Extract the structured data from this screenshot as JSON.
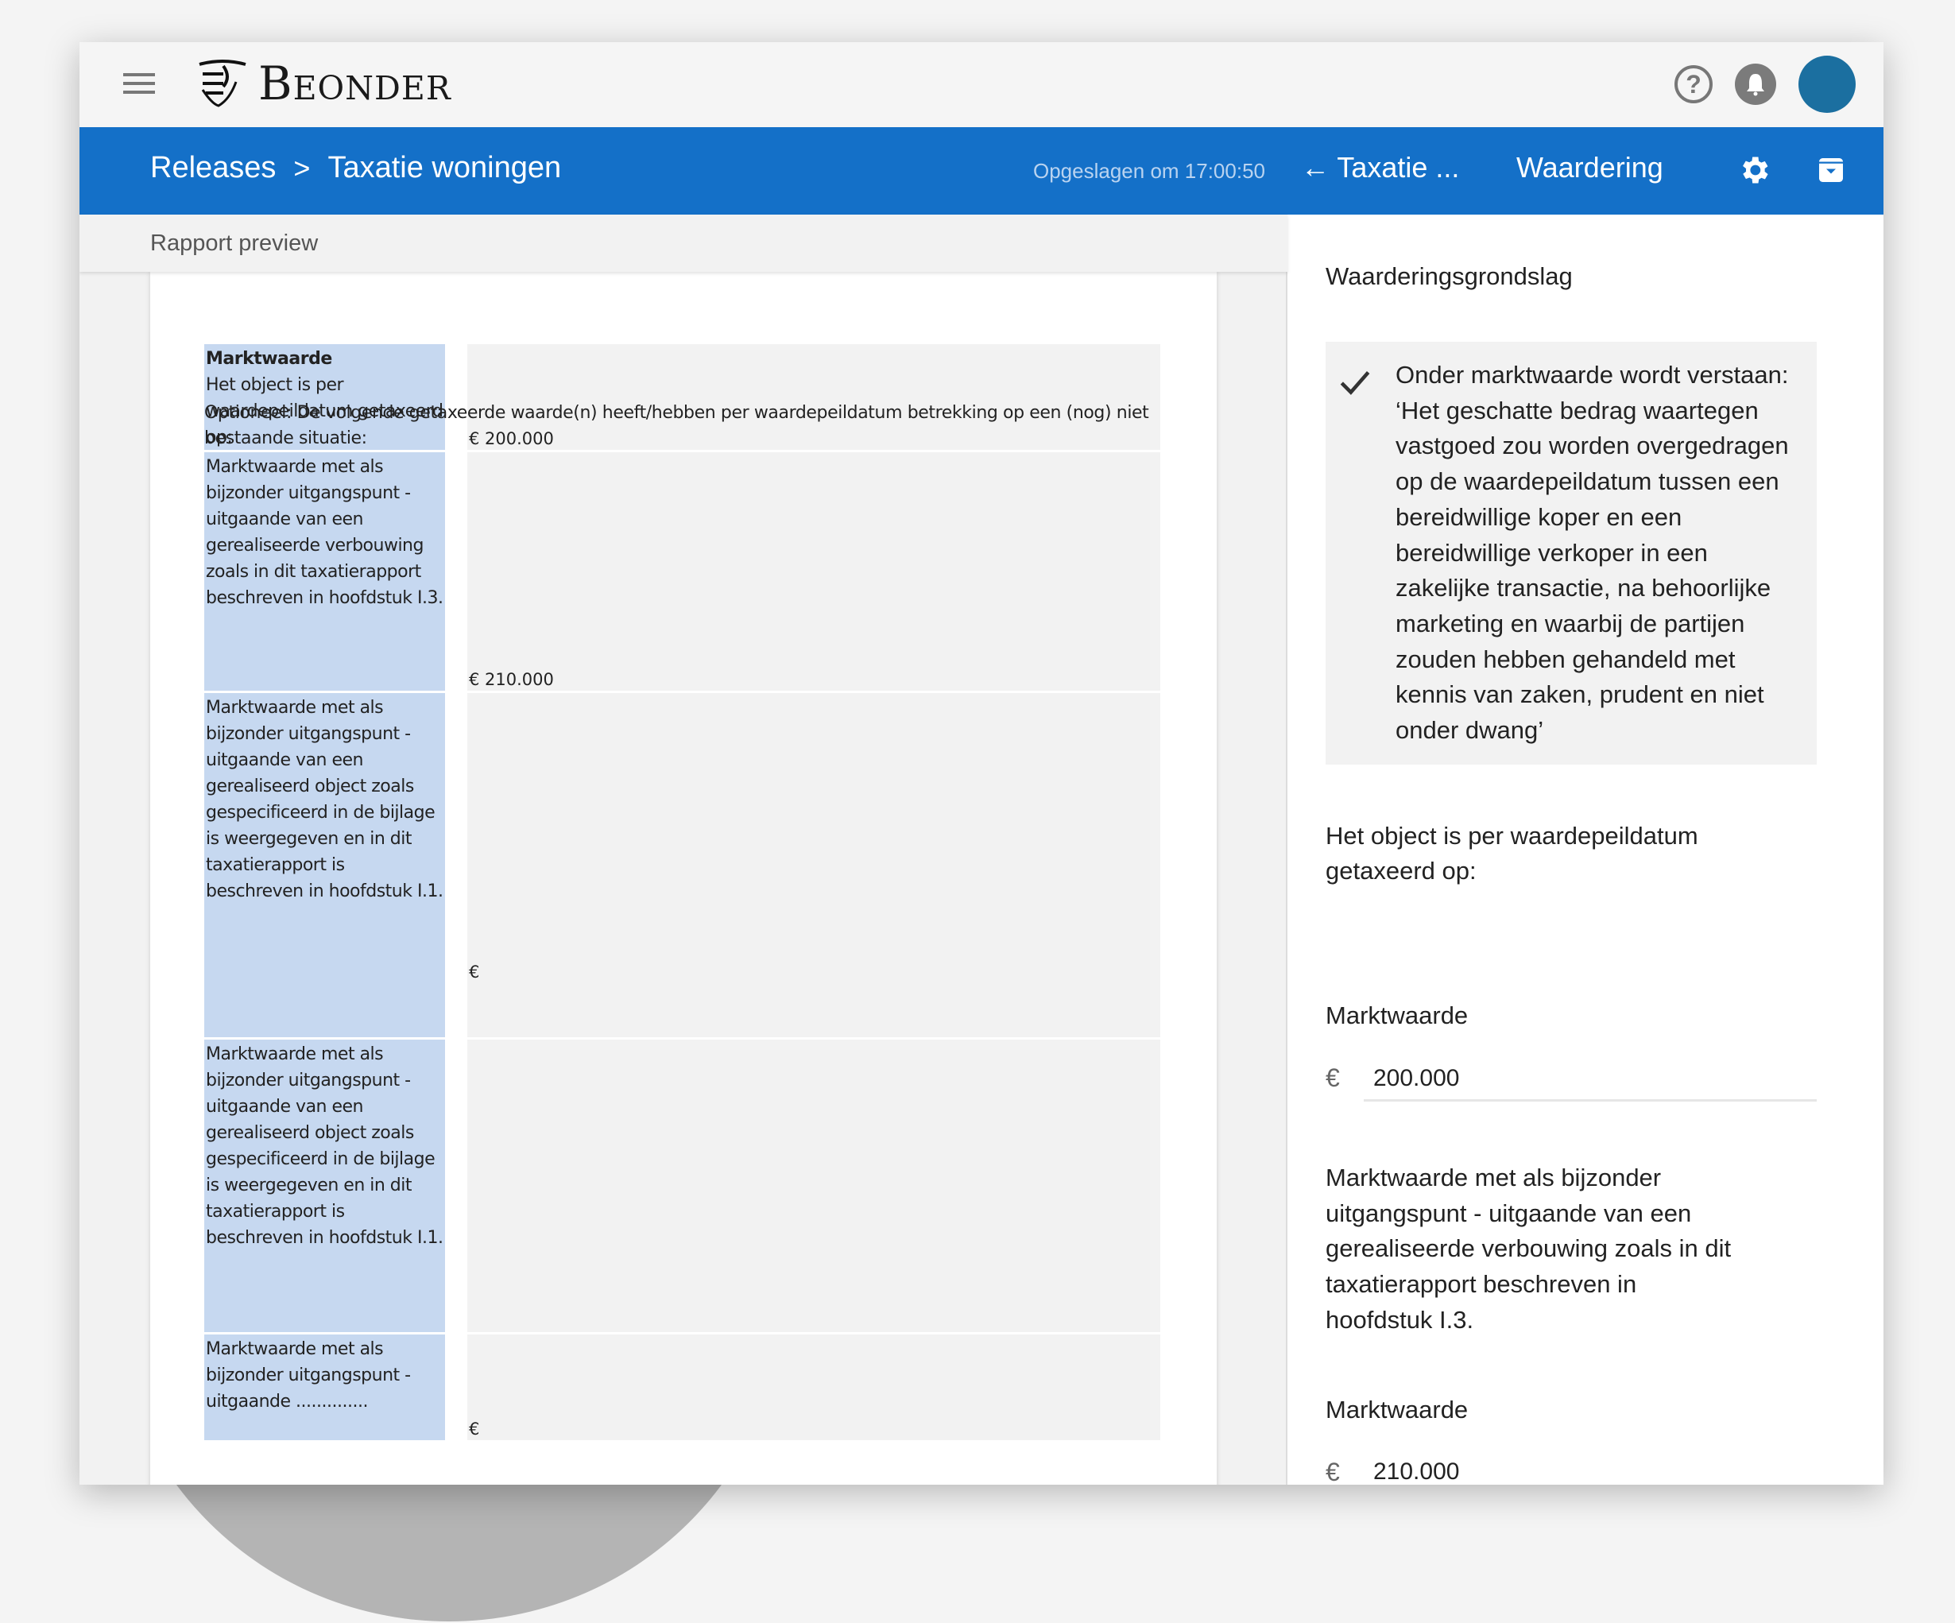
{
  "app": {
    "brand": "Beonder",
    "menu_icon": "hamburger-menu-icon",
    "help_icon": "help-circle-icon",
    "notifications_icon": "bell-icon",
    "avatar_color": "#1b6fa0"
  },
  "toolbar": {
    "breadcrumb": [
      "Releases",
      "Taxatie woningen"
    ],
    "breadcrumb_separator": ">",
    "saved_status": "Opgeslagen om 17:00:50",
    "back_label": "← Taxatie ...",
    "current_section": "Waardering",
    "settings_icon": "gear-icon",
    "save_icon": "save-box-icon",
    "accent_color": "#1470c8"
  },
  "preview": {
    "header": "Rapport preview",
    "rows": [
      {
        "label_bold": "Marktwaarde",
        "label": "Het object is per waardepeildatum getaxeerd op:",
        "value": "€ 200.000"
      }
    ],
    "optional_text": "Optioneel: De volgende getaxeerde waarde(n) heeft/hebben per waardepeildatum betrekking op een (nog) niet bestaande situatie:",
    "optional_rows": [
      {
        "label": "Marktwaarde met als bijzonder uitgangspunt - uitgaande van een gerealiseerde verbouwing zoals in dit taxatierapport beschreven in hoofdstuk I.3.",
        "value": "€ 210.000"
      },
      {
        "label": "Marktwaarde met als bijzonder uitgangspunt - uitgaande van een gerealiseerd object zoals gespecificeerd in de bijlage is weergegeven en in dit taxatierapport is beschreven in hoofdstuk I.1.",
        "value": "€"
      },
      {
        "label": "Marktwaarde met als bijzonder uitgangspunt - uitgaande van een gerealiseerd object zoals gespecificeerd in de bijlage is weergegeven en in dit taxatierapport is beschreven in hoofdstuk I.1.",
        "value": ""
      },
      {
        "label": "Marktwaarde met als bijzonder uitgangspunt - uitgaande ..............",
        "value": "€"
      }
    ]
  },
  "form": {
    "section_title": "Waarderingsgrondslag",
    "definition_checked": true,
    "definition_text": "Onder marktwaarde wordt verstaan: ‘Het geschatte bedrag waartegen vastgoed zou worden overgedragen op de waardepeildatum tussen een bereidwillige koper en een bereidwillige verkoper in een zakelijke transactie, na behoorlijke marketing en waarbij de partijen zouden hebben gehandeld met kennis van zaken, prudent en niet onder dwang’",
    "intro_text": "Het object is per waardepeildatum getaxeerd op:",
    "field1_label": "Marktwaarde",
    "field1_currency": "€",
    "field1_value": "200.000",
    "special_text": "Marktwaarde met als bijzonder uitgangspunt - uitgaande van een gerealiseerde verbouwing zoals in dit taxatierapport beschreven in hoofdstuk I.3.",
    "field2_label": "Marktwaarde",
    "field2_currency": "€",
    "field2_value": "210.000"
  }
}
